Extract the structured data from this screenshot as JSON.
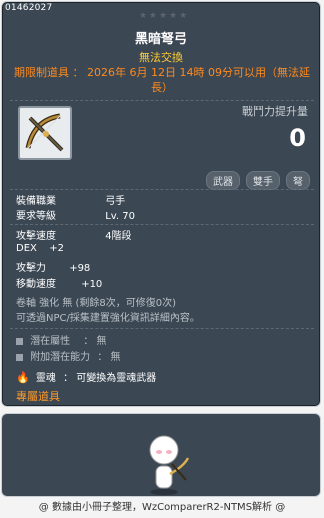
{
  "tooltip": {
    "item_id": "01462027",
    "stars": "★★★★★",
    "name": "黑暗弩弓",
    "tradeable": "無法交換",
    "limited": "期限制道具 ： 2026年 6月 12日 14時 09分可以用（無法延長）",
    "power_label": "戰鬥力提升量",
    "power_value": "0",
    "badges": [
      "武器",
      "雙手",
      "弩"
    ],
    "job_label": "裝備職業",
    "job_value": "弓手",
    "level_label": "要求等級",
    "level_value": "Lv. 70",
    "speed_label": "攻擊速度",
    "speed_value": "4階段",
    "stats": [
      {
        "label": "DEX",
        "value": "+2"
      },
      {
        "label": "攻擊力",
        "value": "+98"
      },
      {
        "label": "移動速度",
        "value": "+10"
      }
    ],
    "upgrade_line1": "卷軸 強化 無 (剩餘8次，可修復0次)",
    "upgrade_line2": "可透過NPC/採集建置強化資訊詳細內容。",
    "potential_label": "潛在屬性",
    "potential_value": "： 無",
    "additional_label": "附加潛在能力",
    "additional_value": "： 無",
    "soul_label": "靈魂",
    "soul_value": "： 可變換為靈魂武器",
    "exclusive": "專屬道具"
  },
  "footer": {
    "credit": "@ 數據由小冊子整理，WzComparerR2-NTMS解析 @"
  }
}
